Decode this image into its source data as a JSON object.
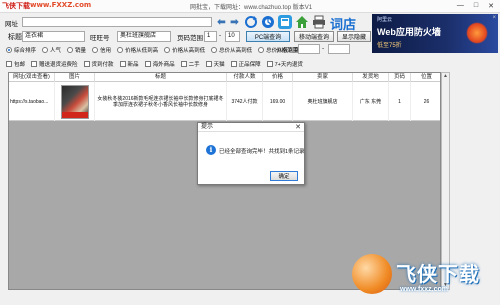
{
  "window": {
    "title": "网批宝，下载网址：www.chazhuo.top 版本V1",
    "minimize": "—",
    "maximize": "□",
    "close": "✕"
  },
  "watermark": {
    "brand": "飞侠下载",
    "url": "www.FXXZ.com"
  },
  "url_bar": {
    "label": "网址",
    "value": ""
  },
  "toolbar": {
    "back_icon": "arrow-left-icon",
    "forward_icon": "arrow-right-icon",
    "refresh_icon": "refresh-icon",
    "query_icon": "query-icon",
    "home_icon": "home-icon",
    "print_icon": "print-icon",
    "word_label": "词店"
  },
  "search": {
    "title_label": "标题",
    "title_value": "连衣裙",
    "wangwang_label": "旺旺号",
    "wangwang_value": "奥杜班旗舰店",
    "page_label": "页码范围",
    "page_from": "1",
    "page_sep": "-",
    "page_to": "10",
    "pc_button": "PC端查询",
    "mobile_button": "移动端查询",
    "toggle_button": "显示隐藏"
  },
  "sort_options": [
    {
      "label": "综合排序",
      "selected": true
    },
    {
      "label": "人气",
      "selected": false
    },
    {
      "label": "销量",
      "selected": false
    },
    {
      "label": "信用",
      "selected": false
    },
    {
      "label": "价格从低到高",
      "selected": false
    },
    {
      "label": "价格从高到低",
      "selected": false
    },
    {
      "label": "总价从高到低",
      "selected": false
    },
    {
      "label": "总价从低到高",
      "selected": false
    }
  ],
  "price_range": {
    "label": "价格范围",
    "from": "",
    "sep": "-",
    "to": ""
  },
  "filter_options": [
    "包邮",
    "赠送退货运费险",
    "货到付款",
    "新品",
    "海外商品",
    "二手",
    "天猫",
    "正品保障",
    "7+天内退货"
  ],
  "table": {
    "columns": [
      "网址(双击查看)",
      "图片",
      "标题",
      "付款人数",
      "价格",
      "卖家",
      "发货地",
      "页码",
      "位置"
    ],
    "rows": [
      {
        "url": "https://s.taobao...",
        "title": "女装秋冬装2016新款毛呢连衣裙长袖中长款修身打底裙冬季加厚连衣裙子秋冬小香风长袖中长款修身",
        "buyers": "3742人付款",
        "price": "169.00",
        "seller": "奥杜班旗舰店",
        "location": "广东 东莞",
        "page": "1",
        "position": "26"
      }
    ]
  },
  "dialog": {
    "title": "提示",
    "close": "✕",
    "icon": "info-icon",
    "message": "已经全部查询完毕！共找到1条记录",
    "ok": "确定"
  },
  "ad": {
    "brand": "阿里云",
    "title": "Web应用防火墙",
    "price": "低至75折",
    "close": "×"
  },
  "logo": {
    "text": "飞侠下载",
    "url": "www.fxxz.com"
  },
  "colors": {
    "accent_blue": "#1e73d6",
    "grid_gray": "#a8a8a8",
    "watermark_red": "#d1211a"
  }
}
